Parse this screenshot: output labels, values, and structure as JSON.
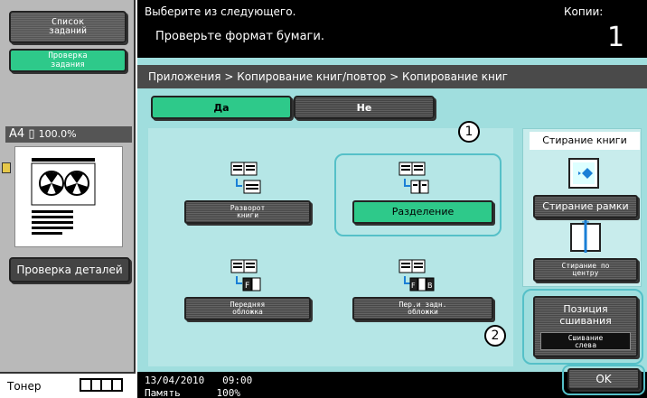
{
  "sidebar": {
    "job_list_label": "Список\nзаданий",
    "job_check_label": "Проверка\nзадания",
    "paper_size": "A4",
    "zoom": "100.0%",
    "details_label": "Проверка деталей",
    "toner_label": "Тонер"
  },
  "header": {
    "title": "Выберите из следующего.",
    "message": "Проверьте формат бумаги.",
    "copies_label": "Копии:",
    "copies_count": "1"
  },
  "breadcrumb": "Приложения > Копирование книг/повтор > Копирование книг",
  "toggle": {
    "yes": "Да",
    "no": "Не"
  },
  "functions": {
    "spread": "Разворот\nкниги",
    "separate": "Разделение",
    "front_cover": "Передняя\nобложка",
    "front_back_cover": "Пер.и задн.\nобложки"
  },
  "book_erase": {
    "title": "Стирание книги",
    "frame_erase": "Стирание рамки",
    "center_erase": "Стирание по\nцентру"
  },
  "binding": {
    "title": "Позиция\nсшивания",
    "value": "Сшивание\nслева"
  },
  "callouts": {
    "one": "1",
    "two": "2"
  },
  "status": {
    "date_time": "13/04/2010   09:00",
    "memory": "Память      100%"
  },
  "ok_label": "OK"
}
